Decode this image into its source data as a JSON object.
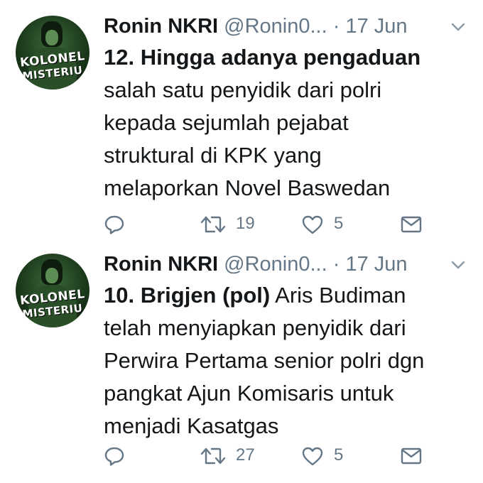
{
  "tweets": [
    {
      "avatar": {
        "line1": "KOLONEL",
        "line2": "MISTERIU"
      },
      "name": "Ronin NKRI",
      "handle": "@Ronin0...",
      "separator": "·",
      "date": "17 Jun",
      "bold_text": "12. Hingga adanya pengaduan",
      "lines": [
        "salah satu penyidik dari polri",
        "kepada sejumlah pejabat",
        "struktural di KPK yang",
        "melaporkan Novel Baswedan"
      ],
      "retweets": "19",
      "likes": "5"
    },
    {
      "avatar": {
        "line1": "KOLONEL",
        "line2": "MISTERIU"
      },
      "name": "Ronin NKRI",
      "handle": "@Ronin0...",
      "separator": "·",
      "date": "17 Jun",
      "bold_text": "10. Brigjen (pol)",
      "first_line_rest": " Aris Budiman",
      "lines": [
        "telah menyiapkan penyidik dari",
        "Perwira Pertama senior polri dgn",
        "pangkat Ajun Komisaris untuk",
        "menjadi Kasatgas"
      ],
      "retweets": "27",
      "likes": "5"
    }
  ],
  "icons": {
    "reply": "reply-icon",
    "retweet": "retweet-icon",
    "like": "heart-icon",
    "dm": "mail-icon",
    "caret": "chevron-down-icon"
  },
  "colors": {
    "text": "#14171a",
    "muted": "#657786"
  }
}
